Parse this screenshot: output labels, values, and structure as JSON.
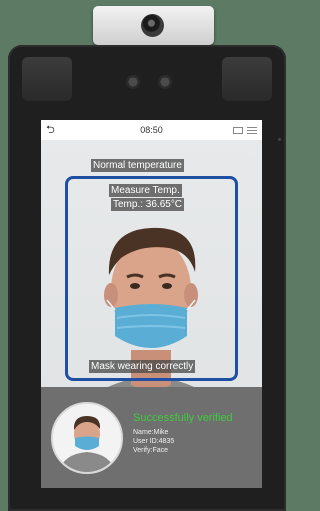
{
  "status_bar": {
    "time": "08:50"
  },
  "labels": {
    "normal_temperature": "Normal temperature",
    "measure_temp": "Measure Temp.",
    "temp_reading": "Temp.: 36.65°C",
    "mask_status": "Mask wearing correctly"
  },
  "verification": {
    "title": "Successfully verified",
    "name": "Name:Mike",
    "user_id": "User ID:4835",
    "verify_mode": "Verify:Face"
  },
  "colors": {
    "frame": "#1e4fa3",
    "verified_text": "#3ecb3e"
  }
}
